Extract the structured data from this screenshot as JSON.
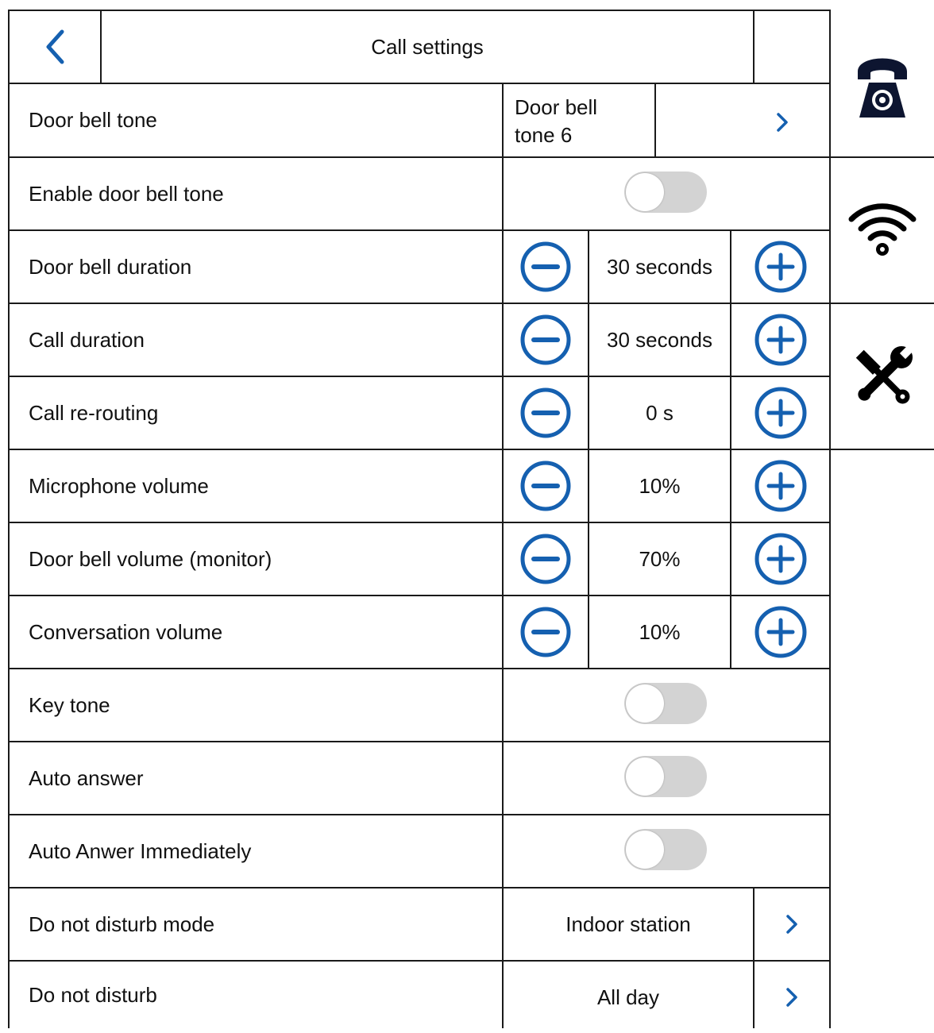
{
  "header": {
    "title": "Call settings",
    "back_icon": "chevron-left-icon"
  },
  "colors": {
    "accent": "#1560b0",
    "toggle_off": "#d3d3d3",
    "border": "#1a1a1a",
    "nav_icon": "#0d1530"
  },
  "rows": [
    {
      "label": "Door bell tone",
      "type": "select-split",
      "value": "Door bell tone 6",
      "value_line1": "Door bell",
      "value_line2": "tone 6"
    },
    {
      "label": "Enable door bell tone",
      "type": "toggle",
      "on": false
    },
    {
      "label": "Door bell duration",
      "type": "stepper",
      "value": "30 seconds"
    },
    {
      "label": "Call duration",
      "type": "stepper",
      "value": "30 seconds"
    },
    {
      "label": "Call re-routing",
      "type": "stepper",
      "value": "0 s"
    },
    {
      "label": "Microphone volume",
      "type": "stepper",
      "value": "10%"
    },
    {
      "label": "Door bell volume (monitor)",
      "type": "stepper",
      "value": "70%"
    },
    {
      "label": "Conversation volume",
      "type": "stepper",
      "value": "10%"
    },
    {
      "label": "Key tone",
      "type": "toggle",
      "on": false
    },
    {
      "label": "Auto answer",
      "type": "toggle",
      "on": false
    },
    {
      "label": "Auto Anwer Immediately",
      "type": "toggle",
      "on": false
    },
    {
      "label": "Do not disturb mode",
      "type": "select",
      "value": "Indoor station"
    },
    {
      "label": "Do not disturb",
      "type": "select",
      "value": "All day"
    }
  ],
  "side_nav": [
    {
      "icon": "phone-settings-icon"
    },
    {
      "icon": "wifi-icon"
    },
    {
      "icon": "tools-icon"
    }
  ]
}
